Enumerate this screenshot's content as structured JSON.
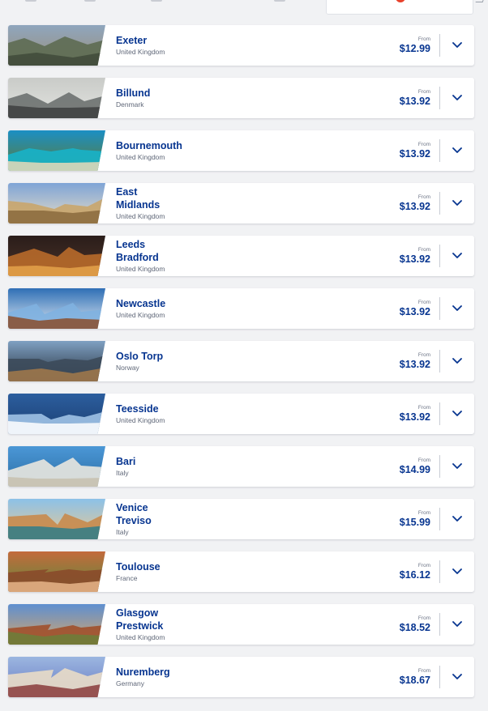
{
  "destinations": [
    {
      "city": "Exeter",
      "country": "United Kingdom",
      "from_label": "From",
      "price": "$12.99",
      "photo": "historic-stone-buildings",
      "palette": [
        "#8fa6be",
        "#5d6b52",
        "#3f4a3a",
        "#9b8f7a"
      ]
    },
    {
      "city": "Billund",
      "country": "Denmark",
      "from_label": "From",
      "price": "$13.92",
      "photo": "modern-geometric-facade",
      "palette": [
        "#c9cbc8",
        "#6d7170",
        "#3d403f",
        "#e2e3df"
      ]
    },
    {
      "city": "Bournemouth",
      "country": "United Kingdom",
      "from_label": "From",
      "price": "$13.92",
      "photo": "turquoise-bay-cliffs",
      "palette": [
        "#1b8fc4",
        "#17b3c9",
        "#e6d9b8",
        "#5c7d3a"
      ]
    },
    {
      "city": "East\nMidlands",
      "country": "United Kingdom",
      "from_label": "From",
      "price": "$13.92",
      "photo": "columned-monument",
      "palette": [
        "#7fa4d6",
        "#c9a56b",
        "#8a6a3d",
        "#e6ddc8"
      ]
    },
    {
      "city": "Leeds\nBradford",
      "country": "United Kingdom",
      "from_label": "From",
      "price": "$13.92",
      "photo": "bridge-at-night",
      "palette": [
        "#2a1d1a",
        "#b86a2a",
        "#e4a24a",
        "#4a3228"
      ]
    },
    {
      "city": "Newcastle",
      "country": "United Kingdom",
      "from_label": "From",
      "price": "$13.92",
      "photo": "angel-sculpture-sky",
      "palette": [
        "#2f6fb5",
        "#7fb1e0",
        "#8a4e2b",
        "#dfe9f3"
      ]
    },
    {
      "city": "Oslo Torp",
      "country": "Norway",
      "from_label": "From",
      "price": "$13.92",
      "photo": "waterfront-skyline",
      "palette": [
        "#7fa0c2",
        "#3c4a5a",
        "#a3794a",
        "#26313d"
      ]
    },
    {
      "city": "Teesside",
      "country": "United Kingdom",
      "from_label": "From",
      "price": "$13.92",
      "photo": "airplane-above-clouds",
      "palette": [
        "#2c5e9e",
        "#9fc2e6",
        "#ffffff",
        "#1b3f73"
      ]
    },
    {
      "city": "Bari",
      "country": "Italy",
      "from_label": "From",
      "price": "$14.99",
      "photo": "white-coastal-town",
      "palette": [
        "#4b97d6",
        "#e9e7df",
        "#c7bfae",
        "#2c6fa6"
      ]
    },
    {
      "city": "Venice\nTreviso",
      "country": "Italy",
      "from_label": "From",
      "price": "$15.99",
      "photo": "canal-domes",
      "palette": [
        "#8cc1e8",
        "#c88a4d",
        "#2f7e8a",
        "#e9c891"
      ]
    },
    {
      "city": "Toulouse",
      "country": "France",
      "from_label": "From",
      "price": "$16.12",
      "photo": "brick-rooftops",
      "palette": [
        "#c36a3c",
        "#8a4a2a",
        "#e7b58a",
        "#5e8a3c"
      ]
    },
    {
      "city": "Glasgow\nPrestwick",
      "country": "United Kingdom",
      "from_label": "From",
      "price": "$18.52",
      "photo": "ornate-museum",
      "palette": [
        "#5e8fd0",
        "#a0502c",
        "#6b7f3a",
        "#d7a66a"
      ]
    },
    {
      "city": "Nuremberg",
      "country": "Germany",
      "from_label": "From",
      "price": "$18.67",
      "photo": "half-timbered-houses",
      "palette": [
        "#9bb6e0",
        "#e9dcc6",
        "#8a3b3b",
        "#6b7cc3"
      ]
    }
  ],
  "icons": {
    "expand": "chevron-down-icon"
  },
  "colors": {
    "primary": "#073590",
    "muted": "#5f6778",
    "background": "#f1f2f4",
    "card": "#ffffff"
  }
}
